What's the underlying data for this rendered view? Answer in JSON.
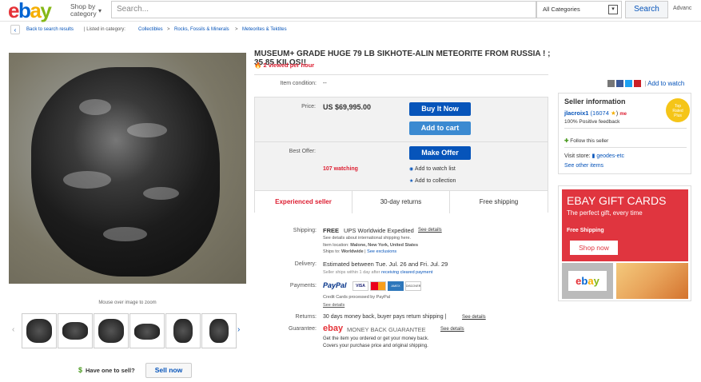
{
  "header": {
    "logo": {
      "e": "e",
      "b": "b",
      "a": "a",
      "y": "y"
    },
    "shop_by": "Shop by",
    "category": "category",
    "search_placeholder": "Search...",
    "category_select": "All Categories",
    "search_button": "Search",
    "advanced": "Advanc"
  },
  "breadcrumb": {
    "back": "Back to search results",
    "listed_in": "| Listed in category:",
    "crumbs": [
      "Collectibles",
      "Rocks, Fossils & Minerals",
      "Meteorites & Tektites"
    ],
    "sep": ">"
  },
  "gallery": {
    "zoom_hint": "Mouse over image to zoom",
    "have_one": "Have one to sell?",
    "sell_now": "Sell now",
    "dollar": "$"
  },
  "item": {
    "title": "MUSEUM+ GRADE HUGE 79 LB SIKHOTE-ALIN METEORITE FROM RUSSIA ! ; 35.85 KILOS!!",
    "viewed": "2 viewed per hour",
    "condition_label": "Item condition:",
    "condition_value": "--",
    "add_to_watch": "Add to watch",
    "price_label": "Price:",
    "price": "US $69,995.00",
    "buy_now": "Buy It Now",
    "add_to_cart": "Add to cart",
    "best_offer_label": "Best Offer:",
    "make_offer": "Make Offer",
    "watching": "107 watching",
    "add_to_watch_list": "Add to watch list",
    "add_to_collection": "Add to collection",
    "tabs": [
      "Experienced seller",
      "30-day returns",
      "Free shipping"
    ],
    "shipping_label": "Shipping:",
    "shipping_free": "FREE",
    "shipping_method": "UPS Worldwide Expedited",
    "see_details": "See details",
    "shipping_intl": "See details about international shipping here.",
    "item_location_label": "Item location:",
    "item_location": "Malone, New York, United States",
    "ships_to_label": "Ships to:",
    "ships_to": "Worldwide",
    "see_exclusions": "See exclusions",
    "delivery_label": "Delivery:",
    "delivery": "Estimated between Tue. Jul. 26 and Fri. Jul. 29",
    "delivery_note": "Seller ships within 1 day after",
    "cleared_payment": "receiving cleared payment",
    "payments_label": "Payments:",
    "paypal": "PayPal",
    "cards": [
      "VISA",
      "",
      "AMEX",
      "DISCOVER"
    ],
    "credit_cards": "Credit Cards processed by PayPal",
    "returns_label": "Returns:",
    "returns": "30 days money back, buyer pays return shipping |",
    "guarantee_label": "Guarantee:",
    "ebay_word": "ebay",
    "mbg": "MONEY BACK GUARANTEE",
    "guarantee_line1": "Get the item you ordered or get your money back.",
    "guarantee_line2": "Covers your purchase price and original shipping."
  },
  "seller": {
    "heading": "Seller information",
    "name": "jlacroix1",
    "feedback": "(16074",
    "star": "★",
    "close_paren": ")",
    "mp": "me",
    "positive": "100% Positive feedback",
    "top_rated": [
      "Top",
      "Rated",
      "Plus"
    ],
    "follow": "Follow this seller",
    "visit_store": "Visit store:",
    "store_name": "geodes-etc",
    "other_items": "See other items"
  },
  "ad": {
    "headline": "EBAY GIFT CARDS",
    "sub": "The perfect gift, every time",
    "free_shipping": "Free Shipping",
    "shop_now": "Shop now",
    "card_logo": "ebay"
  },
  "colors": {
    "accent": "#0654ba",
    "red": "#dd1e31",
    "btn": "#0654ba",
    "btn2": "#3b8ad1",
    "ad_red": "#e0353f"
  }
}
